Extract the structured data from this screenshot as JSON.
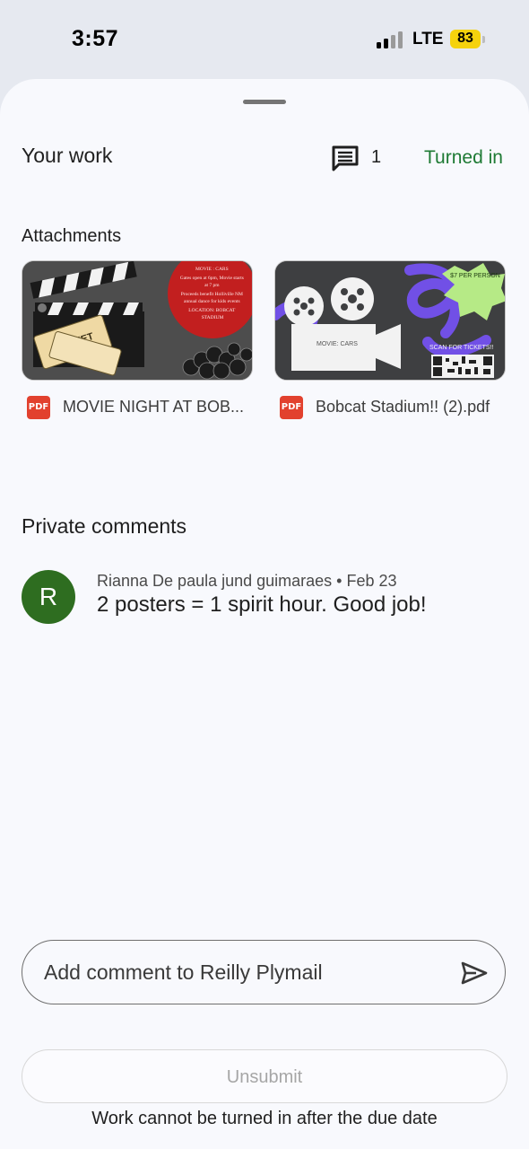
{
  "status_bar": {
    "time": "3:57",
    "network": "LTE",
    "battery": "83"
  },
  "work": {
    "title": "Your work",
    "comment_count": "1",
    "status": "Turned in",
    "status_color": "#1e7a34"
  },
  "attachments": {
    "title": "Attachments",
    "items": [
      {
        "file_name": "MOVIE NIGHT AT BOB...",
        "type_badge": "PDF",
        "icon": "pdf-icon",
        "thumb_badge_lines": [
          "MOVIE : CARS",
          "Gates open at 6pm, Movie starts",
          "at 7 pm",
          "Proceeds benefit Holliville NM",
          "annual dance for kids events",
          "LOCATION: BOBCAT",
          "STADIUM"
        ],
        "thumb_ticket": "TICKET"
      },
      {
        "file_name": "Bobcat Stadium!! (2).pdf",
        "type_badge": "PDF",
        "icon": "pdf-icon",
        "thumb_price": "$7 PER PERSON",
        "thumb_movie": "MOVIE: CARS",
        "thumb_scan": "SCAN FOR TICKETS!!"
      }
    ]
  },
  "private_comments": {
    "title": "Private comments",
    "comments": [
      {
        "avatar_initial": "R",
        "avatar_color": "#2e6d20",
        "meta": "Rianna De paula jund guimaraes • Feb 23",
        "text": "2 posters = 1 spirit hour. Good job!"
      }
    ]
  },
  "comment_box": {
    "placeholder": "Add comment to Reilly Plymail",
    "send_icon": "send-icon"
  },
  "actions": {
    "unsubmit_label": "Unsubmit",
    "footer_note": "Work cannot be turned in after the due date"
  }
}
